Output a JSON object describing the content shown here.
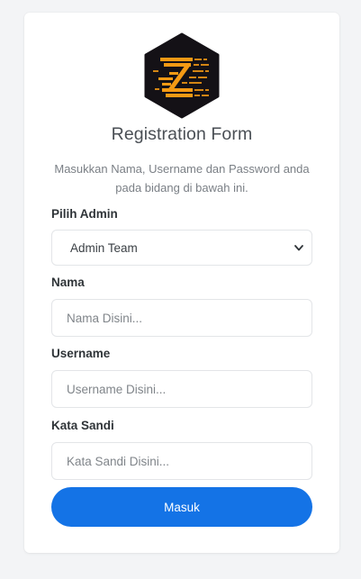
{
  "form": {
    "title": "Registration Form",
    "subtitle": "Masukkan Nama, Username dan Password anda pada bidang di bawah ini.",
    "admin_label": "Pilih Admin",
    "admin_selected": "Admin Team",
    "name_label": "Nama",
    "name_placeholder": "Nama Disini...",
    "username_label": "Username",
    "username_placeholder": "Username Disini...",
    "password_label": "Kata Sandi",
    "password_placeholder": "Kata Sandi Disini...",
    "submit_label": "Masuk"
  },
  "logo": {
    "icon": "hexagon-z-logo",
    "letter": "Z",
    "background_color": "#141116",
    "accent_color": "#f59a14"
  },
  "theme": {
    "primary": "#1473e6",
    "card_background": "#ffffff",
    "page_background": "#f3f4f6"
  }
}
